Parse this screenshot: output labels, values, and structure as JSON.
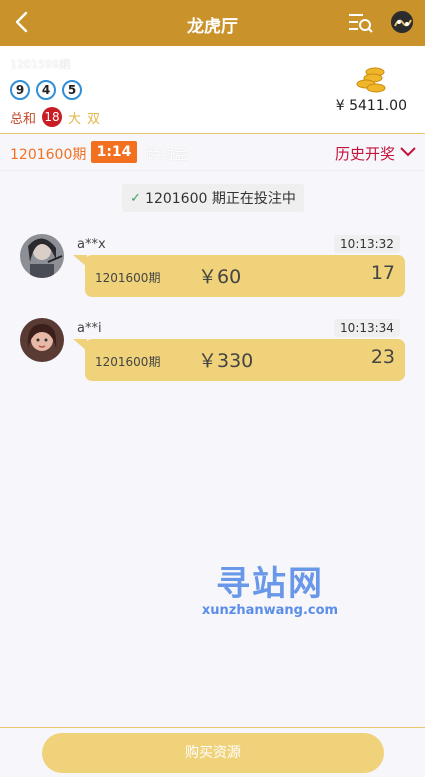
{
  "header": {
    "title": "龙虎厅"
  },
  "last_draw": {
    "issue": "1201599期",
    "balls": [
      "9",
      "4",
      "5"
    ],
    "sum_label": "总和",
    "sum_value": "18",
    "size": "大",
    "parity": "双"
  },
  "balance": "¥ 5411.00",
  "current": {
    "period": "1201600期",
    "timer": "1:14",
    "closing_label": "距封盘",
    "history_label": "历史开奖"
  },
  "status": {
    "text": "1201600 期正在投注中"
  },
  "bets": [
    {
      "user": "a**x",
      "time": "10:13:32",
      "period": "1201600期",
      "amount": "￥60",
      "value": "17"
    },
    {
      "user": "a**i",
      "time": "10:13:34",
      "period": "1201600期",
      "amount": "￥330",
      "value": "23"
    }
  ],
  "watermark": {
    "title": "寻站网",
    "url": "xunzhanwang.com"
  },
  "footer": {
    "buy_label": "购买资源"
  },
  "colors": {
    "brand": "#c9922a",
    "accent_orange": "#f37021",
    "bubble": "#efd27a",
    "history_red": "#c2143a"
  }
}
